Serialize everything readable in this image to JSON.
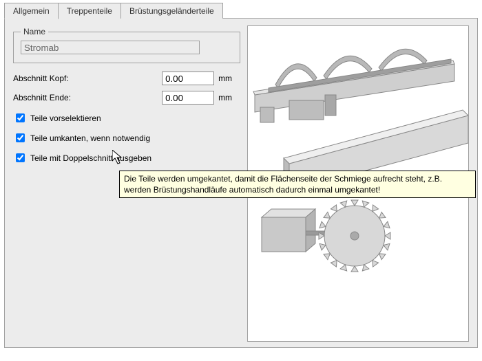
{
  "tabs": [
    {
      "label": "Allgemein",
      "active": true
    },
    {
      "label": "Treppenteile",
      "active": false
    },
    {
      "label": "Brüstungsgeländerteile",
      "active": false
    }
  ],
  "name_box": {
    "legend": "Name",
    "value": "Stromab"
  },
  "fields": {
    "kopf": {
      "label": "Abschnitt Kopf:",
      "value": "0.00",
      "unit": "mm"
    },
    "ende": {
      "label": "Abschnitt Ende:",
      "value": "0.00",
      "unit": "mm"
    }
  },
  "checks": {
    "vorselektieren": {
      "label": "Teile vorselektieren",
      "checked": true
    },
    "umkanten": {
      "label": "Teile umkanten, wenn notwendig",
      "checked": true
    },
    "doppelschnitt": {
      "label": "Teile mit Doppelschnitt ausgeben",
      "checked": true
    }
  },
  "tooltip": "Die Teile werden umgekantet, damit die Flächenseite der Schmiege aufrecht steht, z.B. werden Brüstungshandläufe automatisch dadurch einmal umgekantet!"
}
